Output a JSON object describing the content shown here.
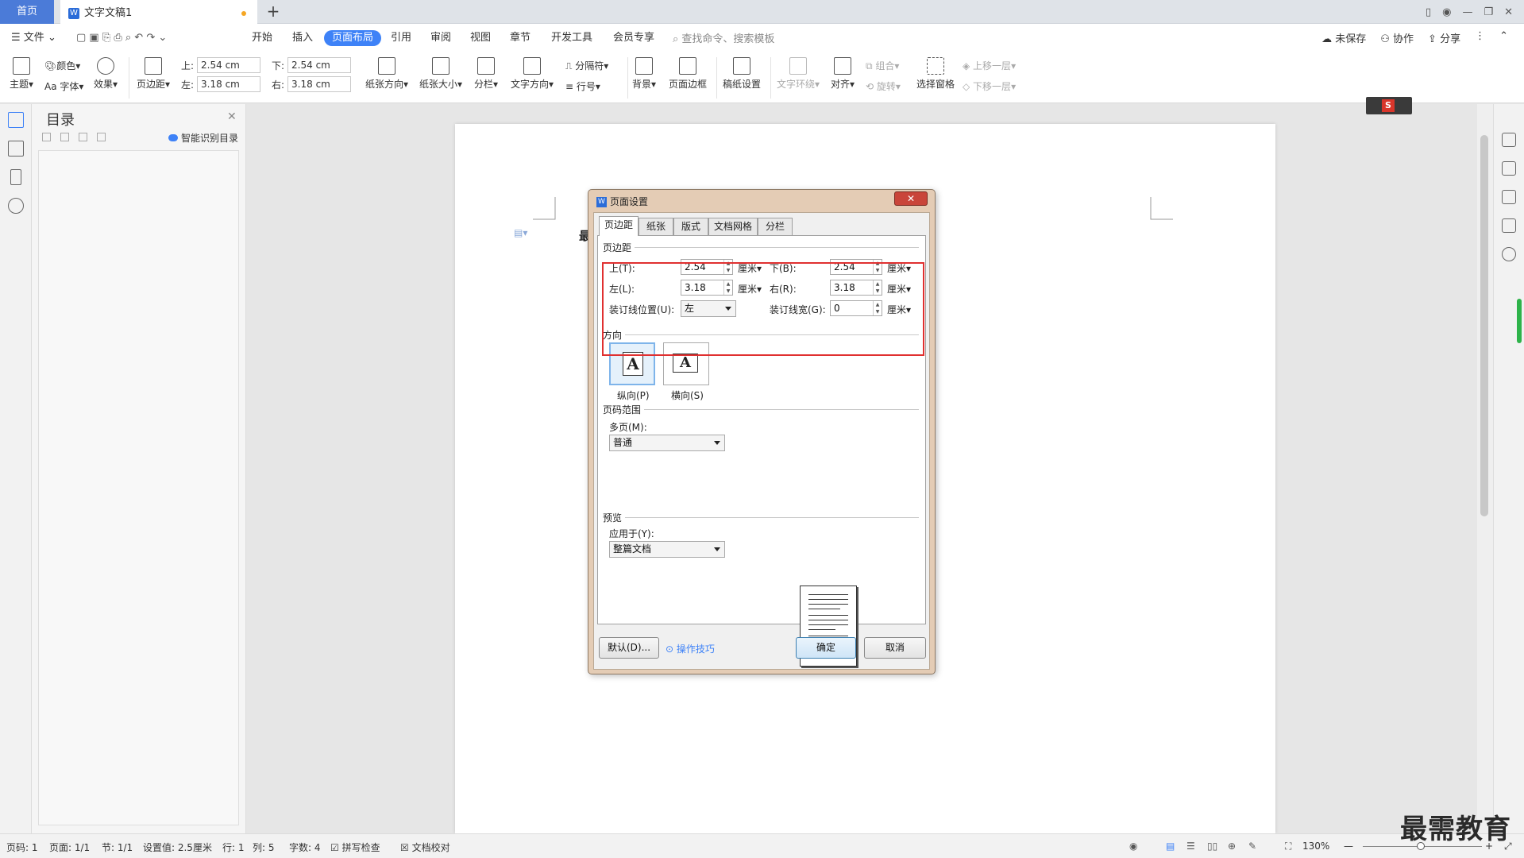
{
  "tabs": {
    "home": "首页",
    "doc": "文字文稿1"
  },
  "menu": {
    "file": "文件",
    "items": [
      "开始",
      "插入",
      "页面布局",
      "引用",
      "审阅",
      "视图",
      "章节",
      "开发工具",
      "会员专享"
    ],
    "search_placeholder": "查找命令、搜索模板",
    "unsaved": "未保存",
    "collab": "协作",
    "share": "分享"
  },
  "ribbon": {
    "theme": "主题",
    "color": "颜色",
    "font": "Aa 字体",
    "effect": "效果",
    "margins": "页边距",
    "top_label": "上:",
    "top_value": "2.54 cm",
    "bottom_label": "下:",
    "bottom_value": "2.54 cm",
    "left_label": "左:",
    "left_value": "3.18 cm",
    "right_label": "右:",
    "right_value": "3.18 cm",
    "orientation": "纸张方向",
    "size": "纸张大小",
    "columns": "分栏",
    "text_dir": "文字方向",
    "separator": "分隔符",
    "line_num": "行号",
    "background": "背景",
    "border": "页面边框",
    "manuscript": "稿纸设置",
    "wrap": "文字环绕",
    "align": "对齐",
    "group": "组合",
    "rotate": "旋转",
    "select_pane": "选择窗格",
    "bring_fwd": "上移一层",
    "send_back": "下移一层"
  },
  "toc": {
    "title": "目录",
    "smart": "智能识别目录"
  },
  "doc": {
    "first_char": "最"
  },
  "dialog": {
    "title": "页面设置",
    "tabs": [
      "页边距",
      "纸张",
      "版式",
      "文档网格",
      "分栏"
    ],
    "margins_group": "页边距",
    "top_label": "上(T):",
    "top_value": "2.54",
    "bottom_label": "下(B):",
    "bottom_value": "2.54",
    "left_label": "左(L):",
    "left_value": "3.18",
    "right_label": "右(R):",
    "right_value": "3.18",
    "gutter_pos_label": "装订线位置(U):",
    "gutter_pos_value": "左",
    "gutter_width_label": "装订线宽(G):",
    "gutter_width_value": "0",
    "unit": "厘米",
    "orient_group": "方向",
    "portrait": "纵向(P)",
    "landscape": "横向(S)",
    "portrait_glyph": "A",
    "landscape_glyph": "A",
    "pages_group": "页码范围",
    "multi_label": "多页(M):",
    "multi_value": "普通",
    "preview_group": "预览",
    "apply_label": "应用于(Y):",
    "apply_value": "整篇文档",
    "default_btn": "默认(D)...",
    "tips": "操作技巧",
    "ok": "确定",
    "cancel": "取消",
    "close": "✕"
  },
  "status": {
    "page_code": "页码: 1",
    "pages": "页面: 1/1",
    "section": "节: 1/1",
    "setting": "设置值: 2.5厘米",
    "row": "行: 1",
    "col": "列: 5",
    "words": "字数: 4",
    "spell": "拼写检查",
    "proof": "文档校对",
    "zoom": "130%"
  },
  "watermark": "最需教育",
  "colors": {
    "accent": "#3e82f7",
    "highlight": "#e03030"
  }
}
